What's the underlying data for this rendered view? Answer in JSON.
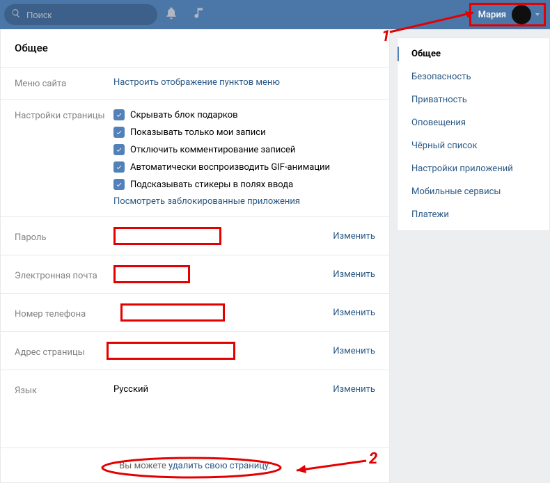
{
  "header": {
    "search_placeholder": "Поиск",
    "user_name": "Мария"
  },
  "page_title": "Общее",
  "sections": {
    "site_menu": {
      "label": "Меню сайта",
      "link": "Настроить отображение пунктов меню"
    },
    "page_settings": {
      "label": "Настройки страницы",
      "options": [
        "Скрывать блок подарков",
        "Показывать только мои записи",
        "Отключить комментирование записей",
        "Автоматически воспроизводить GIF-анимации",
        "Подсказывать стикеры в полях ввода"
      ],
      "blocked_apps_link": "Посмотреть заблокированные приложения"
    },
    "password": {
      "label": "Пароль",
      "change": "Изменить"
    },
    "email": {
      "label": "Электронная почта",
      "change": "Изменить"
    },
    "phone": {
      "label": "Номер телефона",
      "change": "Изменить"
    },
    "address": {
      "label": "Адрес страницы",
      "change": "Изменить"
    },
    "language": {
      "label": "Язык",
      "value": "Русский",
      "change": "Изменить"
    }
  },
  "footer": {
    "prefix": "Вы можете ",
    "link": "удалить свою страницу."
  },
  "sidebar": {
    "items": [
      "Общее",
      "Безопасность",
      "Приватность",
      "Оповещения",
      "Чёрный список",
      "Настройки приложений",
      "Мобильные сервисы",
      "Платежи"
    ]
  },
  "annotations": {
    "one": "1",
    "two": "2"
  }
}
